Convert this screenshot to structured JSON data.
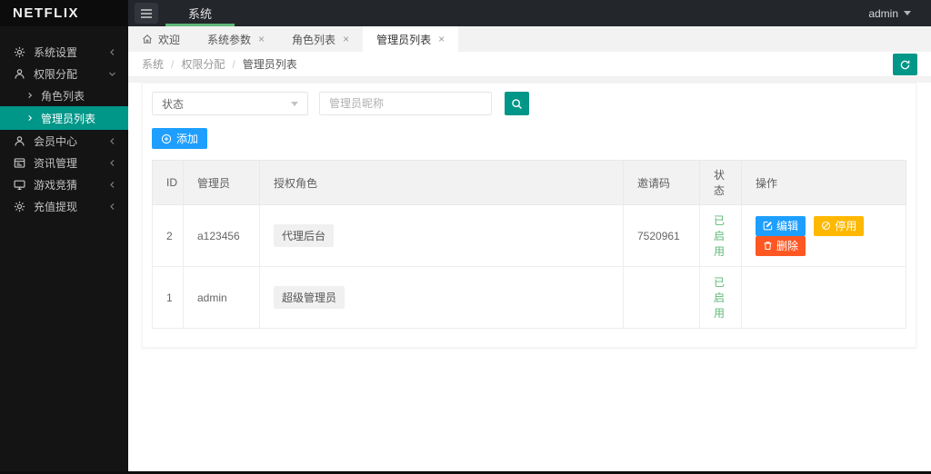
{
  "brand": "NETFLIX",
  "topbar": {
    "nav": [
      {
        "label": "系统",
        "active": true
      }
    ],
    "user_label": "admin"
  },
  "sidebar": {
    "items": [
      {
        "label": "系统设置",
        "icon": "gear-icon",
        "state": "collapsed"
      },
      {
        "label": "权限分配",
        "icon": "user-icon",
        "state": "expanded"
      },
      {
        "label": "会员中心",
        "icon": "member-icon",
        "state": "collapsed"
      },
      {
        "label": "资讯管理",
        "icon": "news-icon",
        "state": "collapsed"
      },
      {
        "label": "游戏竞猜",
        "icon": "monitor-icon",
        "state": "collapsed"
      },
      {
        "label": "充值提现",
        "icon": "recharge-icon",
        "state": "collapsed"
      }
    ],
    "submenu": [
      {
        "label": "角色列表",
        "active": false
      },
      {
        "label": "管理员列表",
        "active": true
      }
    ]
  },
  "tabs": [
    {
      "label": "欢迎",
      "icon": "home-icon",
      "closable": false,
      "active": false
    },
    {
      "label": "系统参数",
      "closable": true,
      "active": false
    },
    {
      "label": "角色列表",
      "closable": true,
      "active": false
    },
    {
      "label": "管理员列表",
      "closable": true,
      "active": true
    }
  ],
  "ui": {
    "close_glyph": "×"
  },
  "breadcrumb": {
    "separator": "/",
    "items": [
      "系统",
      "权限分配",
      "管理员列表"
    ]
  },
  "filter": {
    "status_value": "状态",
    "nickname_placeholder": "管理员昵称"
  },
  "toolbar": {
    "add_label": "添加"
  },
  "table": {
    "columns": [
      "ID",
      "管理员",
      "授权角色",
      "邀请码",
      "状态",
      "操作"
    ],
    "rows": [
      {
        "id": "2",
        "admin": "a123456",
        "role": "代理后台",
        "invite_code": "7520961",
        "status": "已启用",
        "actions": [
          {
            "label": "编辑",
            "type": "edit"
          },
          {
            "label": "停用",
            "type": "disable"
          },
          {
            "label": "删除",
            "type": "delete"
          }
        ]
      },
      {
        "id": "1",
        "admin": "admin",
        "role": "超级管理员",
        "invite_code": "",
        "status": "已启用",
        "actions": []
      }
    ]
  },
  "colors": {
    "theme_teal": "#009688",
    "primary_blue": "#1E9FFF",
    "warning_orange": "#FFB800",
    "danger_red": "#FF5722",
    "success_green": "#5FB878"
  }
}
